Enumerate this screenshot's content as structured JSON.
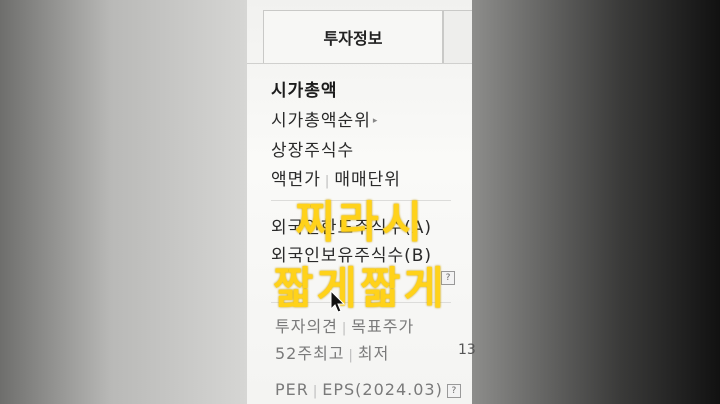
{
  "tab": {
    "active_label": "투자정보"
  },
  "menu": {
    "market_cap": "시가총액",
    "market_cap_rank": "시가총액순위",
    "listed_shares": "상장주식수",
    "par_value": "액면가",
    "trading_unit": "매매단위",
    "foreign_limit": "외국인한도주식수(A)",
    "foreign_holding": "외국인보유주식수(B)",
    "opinion": "투자의견",
    "target_price": "목표주가",
    "high_52": "52주최고",
    "low": "최저",
    "per": "PER",
    "eps": "EPS(2024.03)",
    "cut_value": "13"
  },
  "overlay": {
    "line1": "찌라시",
    "line2": "짧게짧게"
  },
  "colors": {
    "overlay": "#ffd21a"
  }
}
